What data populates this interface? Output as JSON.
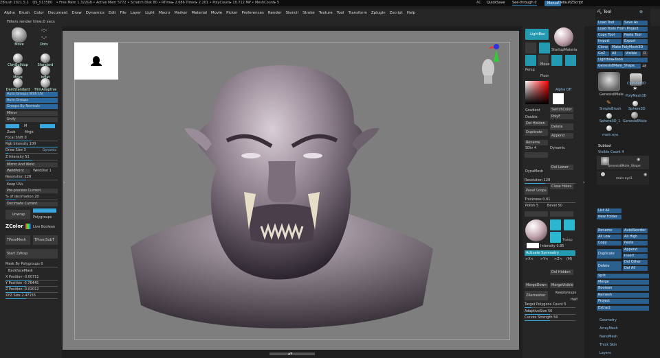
{
  "topbar": {
    "items": [
      "ZBrush 2021.5.1",
      "QS_513580",
      "• Free Mem 1.322GB • Active Mem 5772 • Scratch Disk 80 • RTime▸ 2.686 Timer▸ 2.201 • PolyCount▸ 10.712 MP • MeshCount▸ 5"
    ],
    "ac": "AC",
    "quicksave": "QuickSave",
    "seethrough": "See-through 0",
    "menus_btn": "Menus",
    "script": "DefaultZScript"
  },
  "menu": [
    "Alpha",
    "Brush",
    "Color",
    "Document",
    "Draw",
    "Dynamics",
    "Edit",
    "File",
    "Layer",
    "Light",
    "Macro",
    "Marker",
    "Material",
    "Movie",
    "Picker",
    "Preferences",
    "Render",
    "Stencil",
    "Stroke",
    "Texture",
    "Tool",
    "Transform",
    "Zplugin",
    "Zscript",
    "Help"
  ],
  "subbar": {
    "text": "Filters render time:0 secs"
  },
  "left": {
    "brushes": [
      {
        "label": "Move"
      },
      {
        "label": "Dots"
      },
      {
        "label": "ClayBuildup"
      },
      {
        "label": "Standard"
      },
      {
        "label": "Move"
      },
      {
        "label": "Inflat"
      },
      {
        "label": "DamStandard"
      },
      {
        "label": "TrimAdaptive"
      }
    ],
    "buttons": [
      "Auto Groups With UV",
      "Auto Groups",
      "Groups By Normals",
      "Mirror",
      "Unify"
    ],
    "zsub": "Zsub",
    "mrgb": "Mrgb",
    "m": "M",
    "sliders": [
      {
        "label": "Focal Shift 0",
        "value": 0.5
      },
      {
        "label": "Rgb Intensity 100",
        "value": 1.0
      },
      {
        "label": "Draw Size 3",
        "value": 0.05
      },
      {
        "label": "Z Intensity 51",
        "value": 0.51
      }
    ],
    "dynamic": "Dynamic",
    "mirror_weld": "Mirror And Weld",
    "weldpoint": "WeldPoint",
    "welddist": "WeldDist 1",
    "resolution": "Resolution 128",
    "keepuvs": "Keep UVs",
    "preprocess": "Pre-process Current",
    "decimation": "% of decimation 20",
    "decimate": "Decimate Current",
    "unwrap": "Unwrap",
    "polygroups": "Polygroups",
    "zcolor": "ZColor",
    "liveboolean": "Live Boolean",
    "tposemesh": "TPoseMesh",
    "tposesubt": "TPose|SubT",
    "startzwrap": "Start ZWrap",
    "maskby": "Mask By Polygroups 0",
    "backface": "BackfaceMask",
    "xpos": "X Position -0.00711",
    "ypos": "Y Position -0.76445",
    "zpos": "Z Position -0.02012",
    "xyzsize": "XYZ Size 2.47155"
  },
  "right": {
    "lightbox": "LightBox",
    "material": "StartupMateria",
    "move": "Move",
    "scale": "Scale",
    "rotate": "Rotate",
    "floor": "Floor",
    "alphaoff": "Alpha Off",
    "gradient": "Gradient",
    "switchcolor": "SwitchColor",
    "double": "Double",
    "polyf": "PolyF",
    "delhidden_mesh": "Del Hidden",
    "duplicate": "Duplicate",
    "delete": "Delete",
    "append": "Append",
    "rename": "Rename",
    "sdiv": "SDiv 4",
    "dynamic": "Dynamic",
    "dynamesh": "DynaMesh",
    "dellower": "Del Lower",
    "resolution": "Resolution 128",
    "panelloops": "Panel Loops",
    "closeholes": "Close Holes",
    "thickness": "Thickness 0.01",
    "polish": "Polish 5",
    "bevel": "Bevel 50",
    "zremesher": "ZRemesher",
    "keepgroups": "KeepGroups",
    "half": "Half",
    "target": "Target Polygons Count 5",
    "adaptivesize": "AdaptiveSize 50",
    "curvesstrength": "Curves Strength 50",
    "intensity": "Intensity 0.85",
    "activesym": "Activate Symmetry",
    "x": ">X<",
    "y": ">Y<",
    "z": ">Z<",
    "m": "(M)",
    "delhidden": "Del Hidden",
    "mergedown": "MergeDown",
    "mergevisible": "MergeVisible",
    "transp": "Transp"
  },
  "tool": {
    "title": "Tool",
    "load": "Load Tool",
    "saveas": "Save As",
    "loadproject": "Load Tools From Project",
    "copy": "Copy Tool",
    "paste": "Paste Tool",
    "import": "Import",
    "export": "Export",
    "clone": "Clone",
    "makepoly": "Make PolyMesh3D",
    "goz": "GoZ",
    "all": "All",
    "visible": "Visible",
    "r": "R",
    "lightboxtools": "Lightbox▸Tools",
    "current": "Genesis8Male_Shape.",
    "current_count": "48",
    "tools": [
      "Genesis8Male",
      "Cylinder3D",
      "PolyMesh3D",
      "SimpleBrush",
      "Sphere3D",
      "Sphere3D_1",
      "Genesis8Male",
      "main eye"
    ],
    "subtool": "Subtool",
    "visiblecount": "Visible Count 4",
    "sub1": "Genesis8Male_Shape",
    "sub2": "main eye1",
    "listall": "List All",
    "newfolder": "New Folder",
    "rename": "Rename",
    "autoreorder": "AutoReorder",
    "alllow": "All Low",
    "allhigh": "All High",
    "copysub": "Copy",
    "pastesub": "Paste",
    "duplicate": "Duplicate",
    "append": "Append",
    "insert": "Insert",
    "delete": "Delete",
    "delother": "Del Other",
    "delall": "Del All",
    "split": "Split",
    "merge": "Merge",
    "boolean": "Boolean",
    "remesh": "Remesh",
    "project": "Project",
    "extract": "Extract",
    "geometry": "Geometry",
    "arraymesh": "ArrayMesh",
    "nanomesh": "NanoMesh",
    "thickskin": "Thick Skin",
    "layers": "Layers"
  },
  "colors": {
    "accent": "#2b6aa0",
    "teal": "#239ab0",
    "bg": "#262626",
    "canvas": "#7d7d7d"
  }
}
